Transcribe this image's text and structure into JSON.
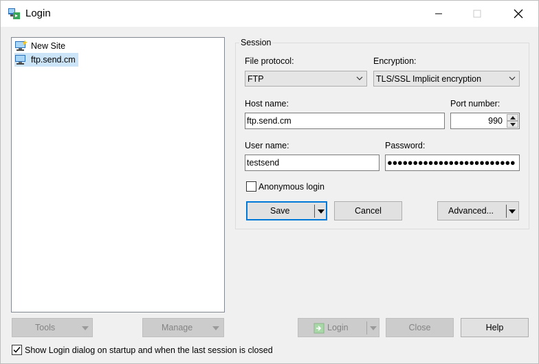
{
  "window": {
    "title": "Login"
  },
  "sites": [
    {
      "label": "New Site",
      "selected": false
    },
    {
      "label": "ftp.send.cm",
      "selected": true
    }
  ],
  "session": {
    "legend": "Session",
    "file_protocol": {
      "label": "File protocol:",
      "value": "FTP"
    },
    "encryption": {
      "label": "Encryption:",
      "value": "TLS/SSL Implicit encryption"
    },
    "host": {
      "label": "Host name:",
      "value": "ftp.send.cm"
    },
    "port": {
      "label": "Port number:",
      "value": "990"
    },
    "user": {
      "label": "User name:",
      "value": "testsend"
    },
    "password": {
      "label": "Password:",
      "masked": "●●●●●●●●●●●●●●●●●●●●●●●●●"
    },
    "anonymous": {
      "label": "Anonymous login",
      "checked": false
    },
    "save_label": "Save",
    "cancel_label": "Cancel",
    "advanced_label": "Advanced..."
  },
  "bottom": {
    "tools_label": "Tools",
    "manage_label": "Manage",
    "login_label": "Login",
    "close_label": "Close",
    "help_label": "Help",
    "startup_label": "Show Login dialog on startup and when the last session is closed",
    "startup_checked": true
  },
  "colors": {
    "accent": "#0078d7",
    "selection": "#cce4f7"
  }
}
